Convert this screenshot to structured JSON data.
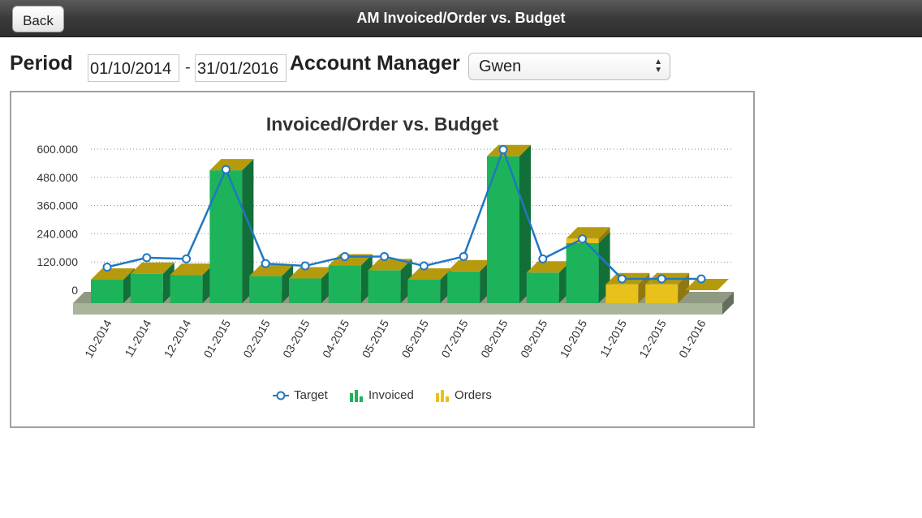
{
  "header": {
    "back_label": "Back",
    "title": "AM Invoiced/Order vs. Budget"
  },
  "filters": {
    "period_label": "Period",
    "start_date": "01/10/2014",
    "separator": "-",
    "end_date": "31/01/2016",
    "manager_label": "Account Manager",
    "manager_value": "Gwen"
  },
  "colors": {
    "invoiced": "#1db35a",
    "orders": "#e8c21a",
    "target": "#1f78c1",
    "base": "#a9b59a"
  },
  "chart_data": {
    "type": "bar",
    "title": "Invoiced/Order vs. Budget",
    "categories": [
      "10-2014",
      "11-2014",
      "12-2014",
      "01-2015",
      "02-2015",
      "03-2015",
      "04-2015",
      "05-2015",
      "06-2015",
      "07-2015",
      "08-2015",
      "09-2015",
      "10-2015",
      "11-2015",
      "12-2015",
      "01-2016"
    ],
    "y_ticks": [
      "600.000",
      "480.000",
      "360.000",
      "240.000",
      "120.000",
      "0"
    ],
    "ylim": [
      0,
      600000
    ],
    "grid": true,
    "legend": "bottom",
    "series": [
      {
        "name": "Target",
        "type": "line",
        "values": [
          50000,
          90000,
          85000,
          465000,
          65000,
          55000,
          95000,
          95000,
          55000,
          95000,
          550000,
          85000,
          170000,
          0,
          0,
          0
        ]
      },
      {
        "name": "Invoiced",
        "type": "bar",
        "values": [
          45000,
          70000,
          65000,
          510000,
          60000,
          50000,
          105000,
          85000,
          45000,
          80000,
          570000,
          75000,
          200000,
          0,
          0,
          0
        ]
      },
      {
        "name": "Orders",
        "type": "bar",
        "values": [
          0,
          0,
          0,
          0,
          0,
          0,
          0,
          0,
          0,
          0,
          0,
          0,
          20000,
          25000,
          25000,
          0
        ]
      }
    ]
  }
}
